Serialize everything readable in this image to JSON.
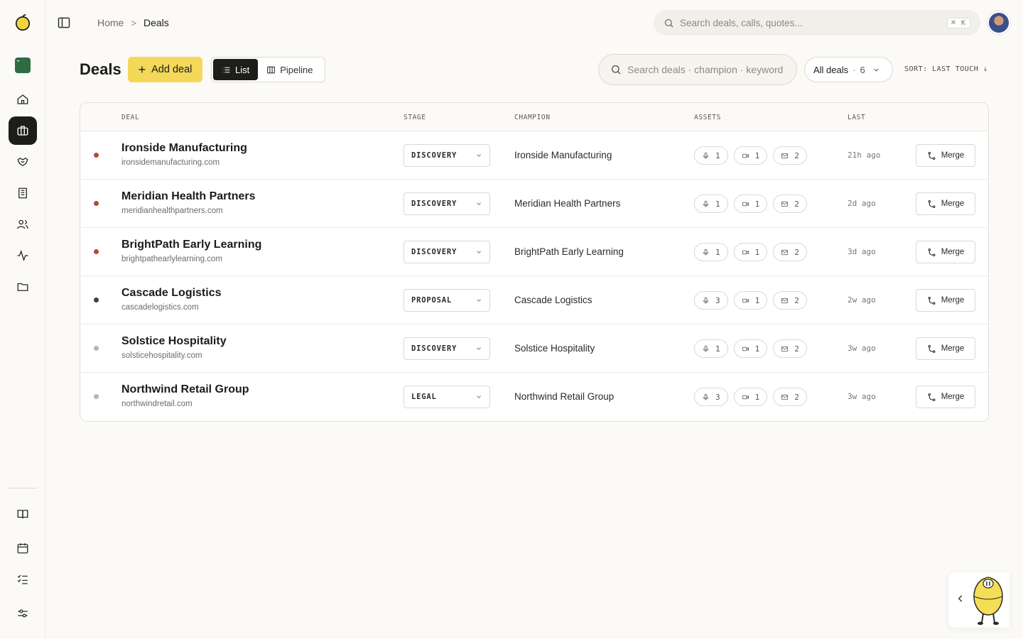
{
  "breadcrumb": {
    "home": "Home",
    "separator": ">",
    "current": "Deals"
  },
  "global_search": {
    "placeholder": "Search deals, calls, quotes...",
    "shortcut": "⌘ K"
  },
  "page": {
    "title": "Deals"
  },
  "toolbar": {
    "add_label": "Add deal",
    "views": [
      {
        "label": "List",
        "active": true
      },
      {
        "label": "Pipeline",
        "active": false
      }
    ],
    "deal_search_placeholder": "Search deals · champion · keyword",
    "filter_label": "All deals",
    "filter_sep": "·",
    "filter_count": "6",
    "sort_label": "SORT: LAST TOUCH ↓"
  },
  "table": {
    "headers": [
      "DEAL",
      "STAGE",
      "CHAMPION",
      "ASSETS",
      "LAST"
    ],
    "merge_label": "Merge",
    "rows": [
      {
        "name": "Ironside Manufacturing",
        "domain": "ironsidemanufacturing.com",
        "stage": "DISCOVERY",
        "champion": "Ironside Manufacturing",
        "calls": "1",
        "videos": "1",
        "emails": "2",
        "last": "21h ago",
        "status_color": "#b24a37"
      },
      {
        "name": "Meridian Health Partners",
        "domain": "meridianhealthpartners.com",
        "stage": "DISCOVERY",
        "champion": "Meridian Health Partners",
        "calls": "1",
        "videos": "1",
        "emails": "2",
        "last": "2d ago",
        "status_color": "#b24a37"
      },
      {
        "name": "BrightPath Early Learning",
        "domain": "brightpathearlylearning.com",
        "stage": "DISCOVERY",
        "champion": "BrightPath Early Learning",
        "calls": "1",
        "videos": "1",
        "emails": "2",
        "last": "3d ago",
        "status_color": "#b24a37"
      },
      {
        "name": "Cascade Logistics",
        "domain": "cascadelogistics.com",
        "stage": "PROPOSAL",
        "champion": "Cascade Logistics",
        "calls": "3",
        "videos": "1",
        "emails": "2",
        "last": "2w ago",
        "status_color": "#2e4a30"
      },
      {
        "name": "Solstice Hospitality",
        "domain": "solsticehospitality.com",
        "stage": "DISCOVERY",
        "champion": "Solstice Hospitality",
        "calls": "1",
        "videos": "1",
        "emails": "2",
        "last": "3w ago",
        "status_color": "#b8b6b0"
      },
      {
        "name": "Northwind Retail Group",
        "domain": "northwindretail.com",
        "stage": "LEGAL",
        "champion": "Northwind Retail Group",
        "calls": "3",
        "videos": "1",
        "emails": "2",
        "last": "3w ago",
        "status_color": "#b8b6b0"
      }
    ]
  },
  "sidebar": {
    "items": [
      "logo-icon",
      "app-icon",
      "home-icon",
      "deals-icon",
      "handshake-icon",
      "building-icon",
      "users-icon",
      "activity-icon",
      "folder-icon",
      "book-icon",
      "calendar-icon",
      "checklist-icon",
      "sliders-icon"
    ],
    "active": "deals-icon"
  },
  "colors": {
    "accent": "#f3d85a",
    "dark": "#1d1d1b",
    "background": "#fbfaf7"
  }
}
